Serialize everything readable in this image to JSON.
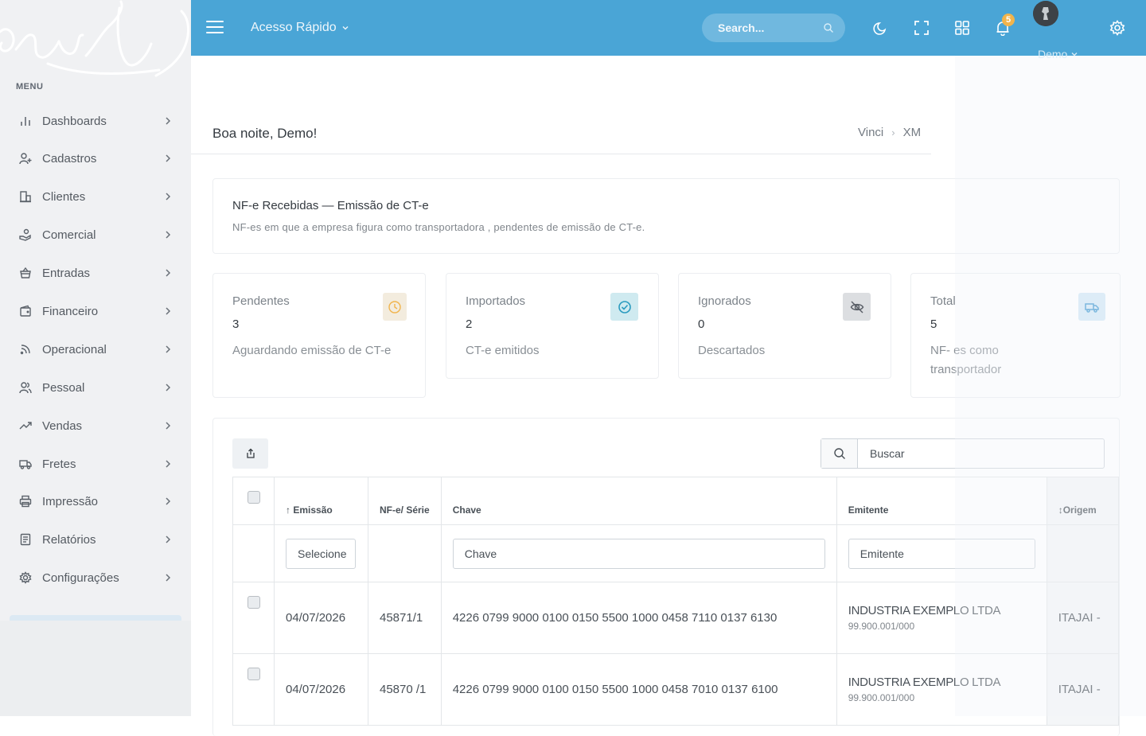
{
  "sidebar": {
    "logo_text": "vinci",
    "menu_title": "MENU",
    "items": [
      {
        "label": "Dashboards",
        "icon": "bar-chart-icon"
      },
      {
        "label": "Cadastros",
        "icon": "user-plus-icon"
      },
      {
        "label": "Clientes",
        "icon": "building-icon"
      },
      {
        "label": "Comercial",
        "icon": "hand-coins-icon"
      },
      {
        "label": "Entradas",
        "icon": "basket-icon"
      },
      {
        "label": "Financeiro",
        "icon": "wallet-icon"
      },
      {
        "label": "Operacional",
        "icon": "rss-icon"
      },
      {
        "label": "Pessoal",
        "icon": "users-icon"
      },
      {
        "label": "Vendas",
        "icon": "trending-up-icon"
      },
      {
        "label": "Fretes",
        "icon": "truck-icon"
      },
      {
        "label": "Impressão",
        "icon": "printer-icon"
      },
      {
        "label": "Relatórios",
        "icon": "document-icon"
      },
      {
        "label": "Configurações",
        "icon": "cog-icon"
      }
    ]
  },
  "topbar": {
    "quick_access": "Acesso Rápido",
    "search_placeholder": "Search...",
    "notifications_count": "5",
    "user_name": "Demo",
    "colors": {
      "bar": "#4aa5d6"
    }
  },
  "page": {
    "greeting": "Boa noite, Demo!",
    "breadcrumb": [
      "Vinci",
      "XM"
    ]
  },
  "intro": {
    "title": "NF-e Recebidas — Emissão de CT-e",
    "subtitle": "NF-es em que a empresa  figura  como  transportadora   , pendentes  de emissão  de CT-e."
  },
  "stats": [
    {
      "label": "Pendentes",
      "value": "3",
      "desc": "Aguardando  emissão  de CT-e",
      "icon": "clock-icon",
      "color": "#f1b44c"
    },
    {
      "label": "Importados",
      "value": "2",
      "desc": "CT-e emitidos",
      "icon": "check-circle-icon",
      "color": "#34c38f"
    },
    {
      "label": "Ignorados",
      "value": "0",
      "desc": "Descartados",
      "icon": "eye-off-icon",
      "color": "#74788d"
    },
    {
      "label": "Total",
      "value": "5",
      "desc": "NF- es como transportador",
      "icon": "truck-icon",
      "color": "#50a5f1"
    }
  ],
  "table": {
    "search_placeholder": "Buscar",
    "headers": {
      "emissao": "Emissão",
      "nfe": "NF-e/ Série",
      "chave": "Chave",
      "emitente": "Emitente",
      "origem": "Origem"
    },
    "filters": {
      "emissao": "Selecione",
      "chave": "Chave",
      "emitente": "Emitente"
    },
    "rows": [
      {
        "emissao": "04/07/2026",
        "nfe": "45871/1",
        "chave": "4226  0799  9000  0100  0150  5500  1000  0458  7110  0137  6130",
        "emitente": "INDUSTRIA EXEMPLO LTDA",
        "cnpj": "99.900.001/000",
        "origem": "ITAJAI -"
      },
      {
        "emissao": "04/07/2026",
        "nfe": "45870 /1",
        "chave": "4226  0799  9000  0100  0150  5500  1000  0458  7010  0137  6100",
        "emitente": "INDUSTRIA EXEMPLO LTDA",
        "cnpj": "99.900.001/000",
        "origem": "ITAJAI -"
      }
    ]
  }
}
